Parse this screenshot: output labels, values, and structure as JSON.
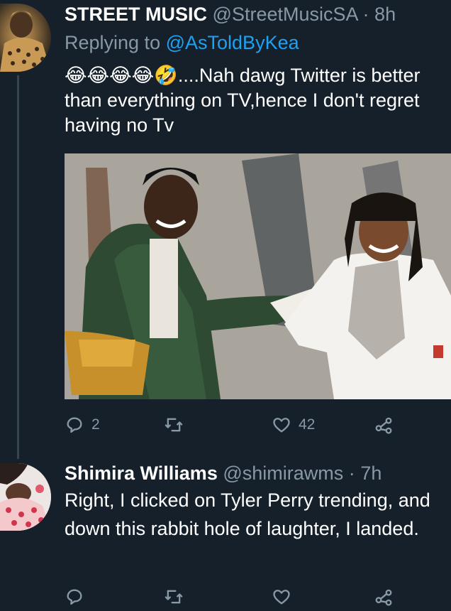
{
  "tweets": [
    {
      "name": "STREET MUSIC",
      "handle": "@StreetMusicSA",
      "separator": "·",
      "time": "8h",
      "replying_prefix": "Replying to",
      "replying_to": "@AsToldByKea",
      "emojis": "😂😂😂😂🤣",
      "text": "....Nah dawg Twitter is better than everything on TV,hence I don't regret having no Tv",
      "actions": {
        "reply_count": "2",
        "retweet_count": "",
        "like_count": "42"
      }
    },
    {
      "name": "Shimira Williams",
      "handle": "@shimirawms",
      "separator": "·",
      "time": "7h",
      "text": "Right, I clicked on Tyler Perry trending, and down this rabbit hole of laughter, I landed.",
      "actions": {
        "reply_count": "",
        "retweet_count": "",
        "like_count": ""
      }
    }
  ],
  "icons": {
    "reply": "reply-icon",
    "retweet": "retweet-icon",
    "like": "heart-icon",
    "share": "share-icon"
  },
  "colors": {
    "background": "#15202b",
    "text_primary": "#ffffff",
    "text_secondary": "#8899a6",
    "link": "#1da1f2",
    "thread_line": "#38444d"
  }
}
